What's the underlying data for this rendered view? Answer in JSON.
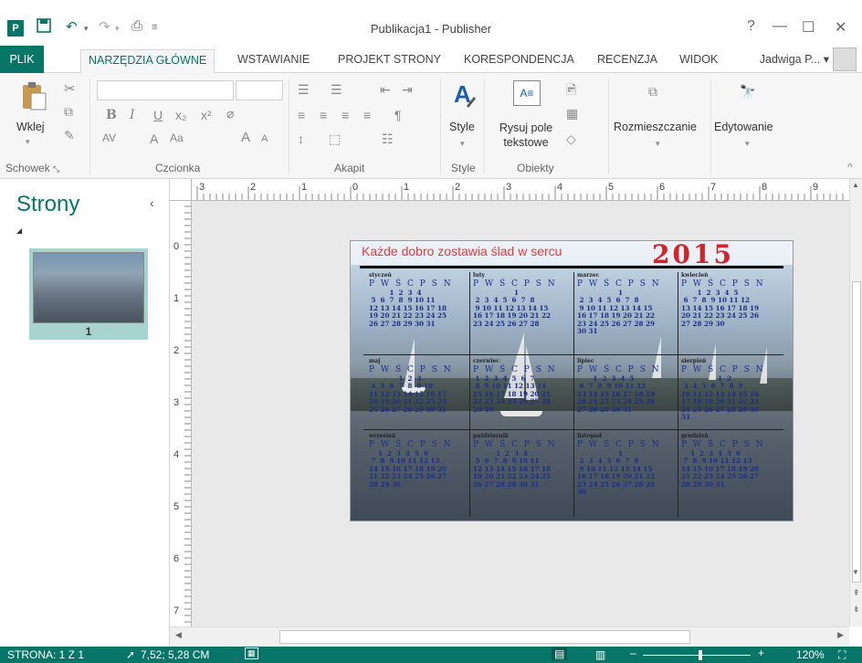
{
  "app": {
    "title": "Publikacja1 - Publisher",
    "icon_label": "P"
  },
  "window_controls": {
    "help": "?",
    "minimize": "—",
    "restore": "☐",
    "close": "✕"
  },
  "tabs": [
    {
      "label": "PLIK"
    },
    {
      "label": "NARZĘDZIA GŁÓWNE"
    },
    {
      "label": "WSTAWIANIE"
    },
    {
      "label": "PROJEKT STRONY"
    },
    {
      "label": "KORESPONDENCJA"
    },
    {
      "label": "RECENZJA"
    },
    {
      "label": "WIDOK"
    }
  ],
  "user": {
    "name": "Jadwiga P...",
    "dropdown": "▾"
  },
  "ribbon": {
    "paste": "Wklej",
    "groups": {
      "clipboard": "Schowek",
      "font": "Czcionka",
      "paragraph": "Akapit",
      "styles": "Style",
      "objects": "Obiekty"
    },
    "style_btn": "Style",
    "draw_textbox": "Rysuj pole",
    "draw_textbox2": "tekstowe",
    "arrange": "Rozmieszczanie",
    "edit": "Edytowanie",
    "font_tools": {
      "bold": "B",
      "italic": "I",
      "underline": "U",
      "sub": "x₂",
      "sup": "x²",
      "aa": "Aa",
      "a_big": "A",
      "a_small": "A",
      "av": "AV",
      "a": "A"
    },
    "collapse": "^"
  },
  "pages_pane": {
    "heading": "Strony",
    "collapse": "‹",
    "expand": "◢",
    "thumbnail_number": "1"
  },
  "ruler": {
    "h_numbers": [
      "3",
      "2",
      "1",
      "0",
      "1",
      "2",
      "3",
      "4",
      "5",
      "6",
      "7",
      "8",
      "9"
    ],
    "v_numbers": [
      "0",
      "1",
      "2",
      "3",
      "4",
      "5",
      "6",
      "7"
    ]
  },
  "publication": {
    "headline": "Każde dobro zostawia ślad w sercu",
    "year": "2015",
    "dow": "P W Ś C P S N",
    "months": [
      {
        "name": "styczeń",
        "days": "         1  2  3  4\n 5  6  7  8  9 10 11\n12 13 14 15 16 17 18\n19 20 21 22 23 24 25\n26 27 28 29 30 31"
      },
      {
        "name": "luty",
        "days": "                  1\n 2  3  4  5  6  7  8\n 9 10 11 12 13 14 15\n16 17 18 19 20 21 22\n23 24 25 26 27 28"
      },
      {
        "name": "marzec",
        "days": "                  1\n 2  3  4  5  6  7  8\n 9 10 11 12 13 14 15\n16 17 18 19 20 21 22\n23 24 25 26 27 28 29\n30 31"
      },
      {
        "name": "kwiecień",
        "days": "       1  2  3  4  5\n 6  7  8  9 10 11 12\n13 14 15 16 17 18 19\n20 21 22 23 24 25 26\n27 28 29 30"
      },
      {
        "name": "maj",
        "days": "             1  2  3\n 4  5  6  7  8  9 10\n11 12 13 14 15 16 17\n18 19 20 21 22 23 24\n25 26 27 28 29 30 31"
      },
      {
        "name": "czerwiec",
        "days": " 1  2  3  4  5  6  7\n 8  9 10 11 12 13 14\n15 16 17 18 19 20 21\n22 23 24 25 26 27 28\n29 30"
      },
      {
        "name": "lipiec",
        "days": "       1  2  3  4  5\n 6  7  8  9 10 11 12\n13 14 15 16 17 18 19\n20 21 22 23 24 25 26\n27 28 29 30 31"
      },
      {
        "name": "sierpień",
        "days": "                1  2\n 3  4  5  6  7  8  9\n10 11 12 13 14 15 16\n17 18 19 20 21 22 23\n24 25 26 27 28 29 30\n31"
      },
      {
        "name": "wrzesień",
        "days": "    1  2  3  4  5  6\n 7  8  9 10 11 12 13\n14 15 16 17 18 19 20\n21 22 23 24 25 26 27\n28 29 30"
      },
      {
        "name": "październik",
        "days": "          1  2  3  4\n 5  6  7  8  9 10 11\n12 13 14 15 16 17 18\n19 20 21 22 23 24 25\n26 27 28 29 30 31"
      },
      {
        "name": "listopad",
        "days": "                  1\n 2  3  4  5  6  7  8\n 9 10 11 12 13 14 15\n16 17 18 19 20 21 22\n23 24 25 26 27 28 29\n30"
      },
      {
        "name": "grudzień",
        "days": "    1  2  3  4  5  6\n 7  8  9 10 11 12 13\n14 15 16 17 18 19 20\n21 22 23 24 25 26 27\n28 29 30 31"
      }
    ]
  },
  "status": {
    "page": "STRONA: 1 Z 1",
    "position": "7,52; 5,28 CM",
    "zoom": "120%",
    "zoom_level": 120
  },
  "colors": {
    "accent": "#077568",
    "headline": "#e53a3a",
    "year": "#d2222a"
  }
}
